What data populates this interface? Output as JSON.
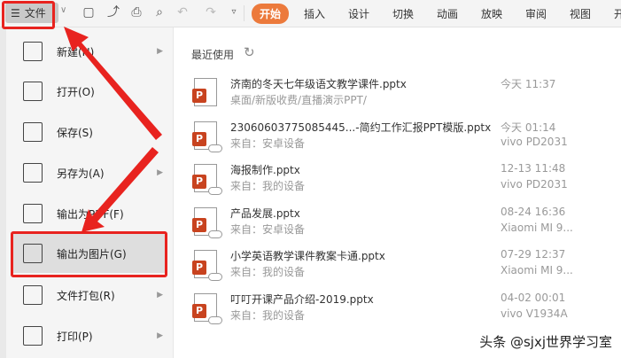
{
  "toolbar": {
    "file_label": "文件",
    "tabs": [
      "开始",
      "插入",
      "设计",
      "切换",
      "动画",
      "放映",
      "审阅",
      "视图",
      "开"
    ]
  },
  "menu": [
    {
      "label": "新建(N)",
      "submenu": true,
      "icon": "new-file-icon"
    },
    {
      "label": "打开(O)",
      "submenu": false,
      "icon": "folder-icon"
    },
    {
      "label": "保存(S)",
      "submenu": false,
      "icon": "save-icon"
    },
    {
      "label": "另存为(A)",
      "submenu": true,
      "icon": "save-as-icon"
    },
    {
      "label": "输出为PDF(F)",
      "submenu": false,
      "icon": "export-pdf-icon"
    },
    {
      "label": "输出为图片(G)",
      "submenu": false,
      "icon": "export-image-icon"
    },
    {
      "label": "文件打包(R)",
      "submenu": true,
      "icon": "package-icon"
    },
    {
      "label": "打印(P)",
      "submenu": true,
      "icon": "print-icon"
    }
  ],
  "recent": {
    "title": "最近使用",
    "files": [
      {
        "name": "济南的冬天七年级语文教学课件.pptx",
        "sub": "桌面/新版收费/直播演示PPT/",
        "time": "今天 11:37",
        "device": ""
      },
      {
        "name": "23060603775085445...-简约工作汇报PPT模版.pptx",
        "sub": "来自：安卓设备",
        "time": "今天 01:14",
        "device": "vivo PD2031"
      },
      {
        "name": "海报制作.pptx",
        "sub": "来自：我的设备",
        "time": "12-13 11:48",
        "device": "vivo PD2031"
      },
      {
        "name": "产品发展.pptx",
        "sub": "来自：安卓设备",
        "time": "08-24 16:36",
        "device": "Xiaomi MI 9..."
      },
      {
        "name": "小学英语教学课件教案卡通.pptx",
        "sub": "来自：我的设备",
        "time": "07-29 12:37",
        "device": "Xiaomi MI 9..."
      },
      {
        "name": "叮叮开课产品介绍-2019.pptx",
        "sub": "来自：我的设备",
        "time": "04-02 00:01",
        "device": "vivo V1934A"
      }
    ]
  },
  "watermark": "头条 @sjxj世界学习室",
  "colors": {
    "accent": "#ec7a3c",
    "highlight": "#e8231f",
    "ppt": "#c8431f"
  }
}
